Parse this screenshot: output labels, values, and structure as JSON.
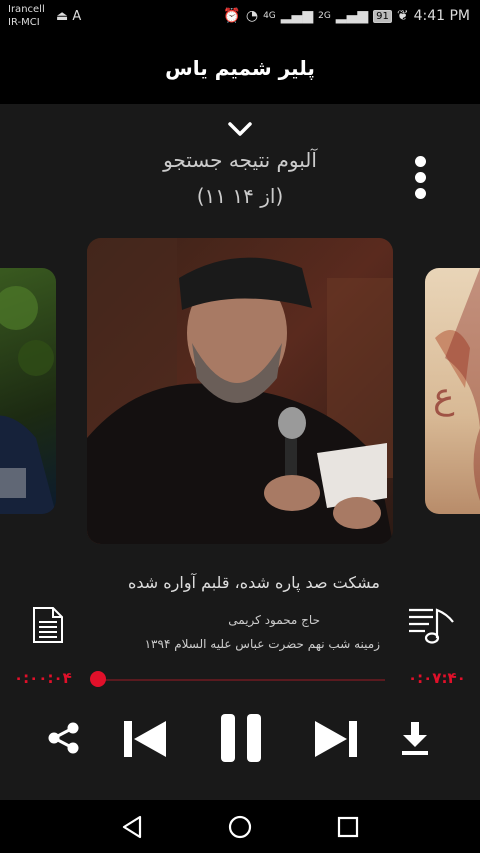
{
  "status_bar": {
    "carrier_line1": "Irancell",
    "carrier_line2": "IR-MCI",
    "left_icons": "⏏ A",
    "network1": "4G",
    "network2": "2G",
    "battery": "91",
    "time": "4:41 PM"
  },
  "app_bar": {
    "title": "پلیر شمیم یاس"
  },
  "player": {
    "album_title": "آلبوم نتیجه جستجو",
    "album_count": "(۱۱ از ۱۴)",
    "track_title": "مشکت صد پاره شده، قلبم آواره شده",
    "artist": "حاج محمود کریمی",
    "subtitle": "زمینه  شب نهم  حضرت عباس علیه السلام  ۱۳۹۴",
    "elapsed": "۰:۰۰:۰۴",
    "duration": "۰:۰۷:۴۰",
    "progress": 0.01
  },
  "icons": {
    "collapse": "chevron-down-icon",
    "more": "more-vertical-icon",
    "lyrics": "document-icon",
    "playlist": "playlist-icon",
    "share": "share-icon",
    "previous": "skip-previous-icon",
    "pause": "pause-icon",
    "next": "skip-next-icon",
    "download": "download-icon"
  },
  "colors": {
    "accent": "#e1102a",
    "background": "#191919"
  }
}
